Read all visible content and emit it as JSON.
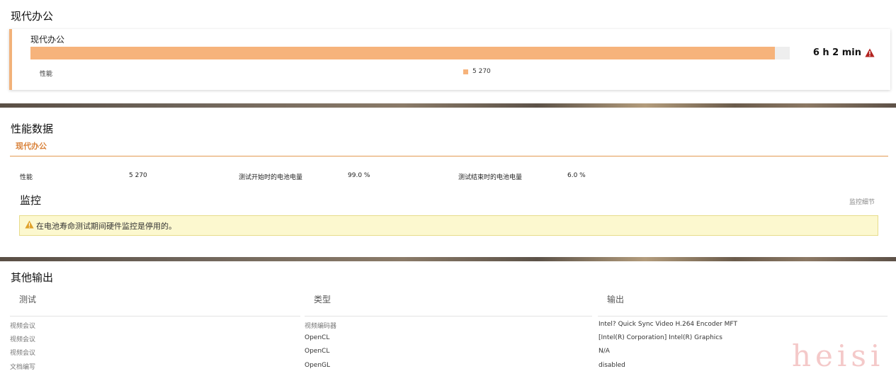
{
  "section1": {
    "title": "现代办公",
    "card": {
      "label": "现代办公",
      "bar_caption": "性能",
      "legend_value": "5 270",
      "bar_fraction": 0.98,
      "bar_color": "#f6b37b",
      "duration": "6 h 2 min",
      "duration_icon": "warning-icon"
    }
  },
  "perf": {
    "title": "性能数据",
    "tab": "现代办公",
    "metrics": [
      {
        "label": "性能",
        "value": "5 270"
      },
      {
        "label": "测试开始时的电池电量",
        "value": "99.0 %"
      },
      {
        "label": "测试结束时的电池电量",
        "value": "6.0 %"
      }
    ]
  },
  "monitor": {
    "title": "监控",
    "link": "监控细节",
    "alert_text": "在电池寿命测试期间硬件监控是停用的。",
    "alert_icon": "warning-icon"
  },
  "other": {
    "title": "其他输出",
    "headers": [
      "测试",
      "类型",
      "输出"
    ],
    "rows": [
      [
        "视频会议",
        "视频编码器",
        "Intel? Quick Sync Video H.264 Encoder MFT"
      ],
      [
        "视频会议",
        "OpenCL",
        "[Intel(R) Corporation] Intel(R) Graphics"
      ],
      [
        "视频会议",
        "OpenCL",
        "N/A"
      ],
      [
        "文档编写",
        "OpenGL",
        "disabled"
      ]
    ]
  },
  "watermark": "heisi",
  "colors": {
    "accent": "#f6b37b",
    "tab": "#d9823a",
    "alert_bg": "#fcf8cf"
  }
}
